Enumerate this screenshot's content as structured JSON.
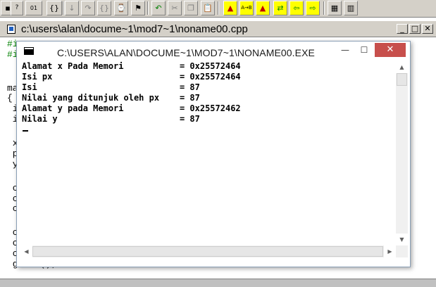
{
  "toolbar": {
    "buttons": [
      {
        "icon": "glyph-icon",
        "glyph": "▪"
      },
      {
        "icon": "help-index-icon",
        "glyph": "?"
      },
      {
        "icon": "binary-view-icon",
        "glyph": "01"
      },
      {
        "icon": "open-braces-icon",
        "glyph": "{}"
      },
      {
        "icon": "step-into-icon",
        "glyph": "↓"
      },
      {
        "icon": "step-over-icon",
        "glyph": "↷"
      },
      {
        "icon": "braces-icon",
        "glyph": "{}"
      },
      {
        "icon": "watch-icon",
        "glyph": "⌚"
      },
      {
        "icon": "inspect-icon",
        "glyph": "⚑"
      },
      {
        "icon": "evaluate-icon",
        "glyph": "▤"
      },
      {
        "icon": "undo-icon",
        "glyph": "↶"
      },
      {
        "icon": "cut-icon",
        "glyph": "✂"
      },
      {
        "icon": "copy-icon",
        "glyph": "❐"
      },
      {
        "icon": "paste-icon",
        "glyph": "📋"
      },
      {
        "icon": "find-icon",
        "glyph": "▲"
      },
      {
        "icon": "replace-icon",
        "glyph": "A→B"
      },
      {
        "icon": "search-again-icon",
        "glyph": "▲"
      },
      {
        "icon": "browse-icon",
        "glyph": "⇄"
      },
      {
        "icon": "back-icon",
        "glyph": "⇦"
      },
      {
        "icon": "forward-icon",
        "glyph": "⇨"
      },
      {
        "icon": "tile-icon",
        "glyph": "▦"
      },
      {
        "icon": "cascade-icon",
        "glyph": "▥"
      }
    ]
  },
  "editor": {
    "title": "c:\\users\\alan\\docume~1\\mod7~1\\noname00.cpp",
    "min_label": "_",
    "max_label": "□",
    "close_label": "✕",
    "code_lines": [
      "#i",
      "#i",
      "",
      "",
      "ma",
      "{",
      " i",
      " i",
      "",
      " x",
      " p",
      " y",
      "",
      " c",
      " c",
      " c",
      "",
      " c",
      " c",
      " c",
      " getch();"
    ]
  },
  "console": {
    "title": "C:\\USERS\\ALAN\\DOCUME~1\\MOD7~1\\NONAME00.EXE",
    "min_label": "—",
    "max_label": "☐",
    "close_label": "✕",
    "lines": [
      "Alamat x Pada Memori           = 0x25572464",
      "Isi px                         = 0x25572464",
      "Isi                            = 87",
      "Nilai yang ditunjuk oleh px    = 87",
      "Alamat y pada Memori           = 0x25572462",
      "Nilai y                        = 87"
    ],
    "scroll_up": "▲",
    "scroll_down": "▼",
    "scroll_left": "◀",
    "scroll_right": "▶"
  }
}
